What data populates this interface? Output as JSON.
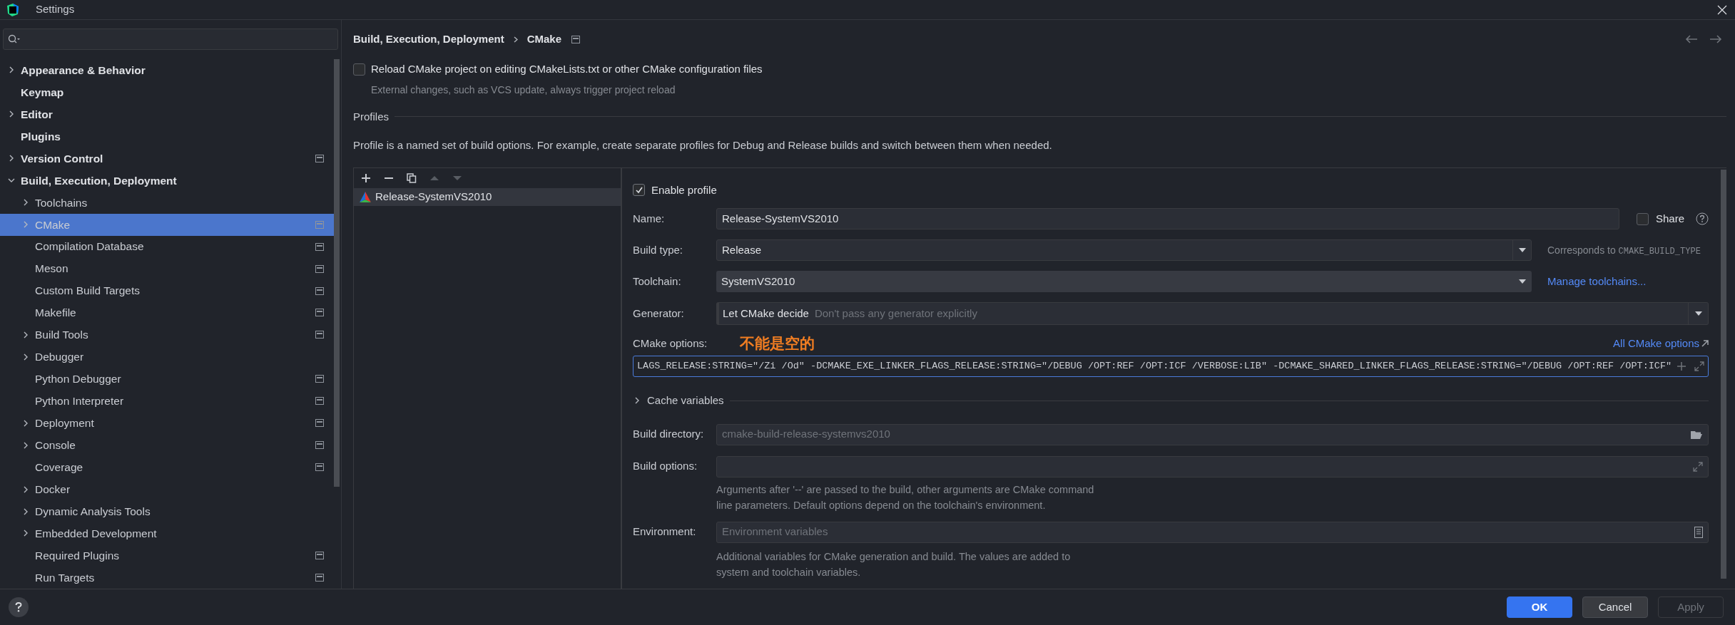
{
  "window": {
    "title": "Settings"
  },
  "sidebar": {
    "items": [
      {
        "label": "Appearance & Behavior",
        "expanded": false,
        "selected": false,
        "project_level": false
      },
      {
        "label": "Keymap",
        "selected": false,
        "project_level": false
      },
      {
        "label": "Editor",
        "expanded": false,
        "selected": false,
        "project_level": false
      },
      {
        "label": "Plugins",
        "selected": false,
        "project_level": false
      },
      {
        "label": "Version Control",
        "expanded": false,
        "selected": false,
        "project_level": true
      },
      {
        "label": "Build, Execution, Deployment",
        "expanded": true,
        "selected": false,
        "project_level": false,
        "children": [
          {
            "label": "Toolchains",
            "expanded": false,
            "selected": false,
            "project_level": false
          },
          {
            "label": "CMake",
            "expanded": false,
            "selected": true,
            "project_level": true
          },
          {
            "label": "Compilation Database",
            "selected": false,
            "project_level": true
          },
          {
            "label": "Meson",
            "selected": false,
            "project_level": true
          },
          {
            "label": "Custom Build Targets",
            "selected": false,
            "project_level": true
          },
          {
            "label": "Makefile",
            "selected": false,
            "project_level": true
          },
          {
            "label": "Build Tools",
            "expanded": false,
            "selected": false,
            "project_level": true
          },
          {
            "label": "Debugger",
            "expanded": false,
            "selected": false,
            "project_level": false
          },
          {
            "label": "Python Debugger",
            "selected": false,
            "project_level": true
          },
          {
            "label": "Python Interpreter",
            "selected": false,
            "project_level": true
          },
          {
            "label": "Deployment",
            "expanded": false,
            "selected": false,
            "project_level": true
          },
          {
            "label": "Console",
            "expanded": false,
            "selected": false,
            "project_level": true
          },
          {
            "label": "Coverage",
            "selected": false,
            "project_level": true
          },
          {
            "label": "Docker",
            "expanded": false,
            "selected": false,
            "project_level": false
          },
          {
            "label": "Dynamic Analysis Tools",
            "expanded": false,
            "selected": false,
            "project_level": false
          },
          {
            "label": "Embedded Development",
            "expanded": false,
            "selected": false,
            "project_level": false
          },
          {
            "label": "Required Plugins",
            "selected": false,
            "project_level": true
          },
          {
            "label": "Run Targets",
            "selected": false,
            "project_level": true
          }
        ]
      }
    ]
  },
  "breadcrumb": {
    "items": [
      "Build, Execution, Deployment",
      "CMake"
    ],
    "project_level": true
  },
  "reload_option": {
    "label": "Reload CMake project on editing CMakeLists.txt or other CMake configuration files",
    "checked": false,
    "hint": "External changes, such as VCS update, always trigger project reload"
  },
  "profiles": {
    "title": "Profiles",
    "description": "Profile is a named set of build options. For example, create separate profiles for Debug and Release builds and switch between them when needed.",
    "toolbar": [
      {
        "kind": "add",
        "disabled": false
      },
      {
        "kind": "remove",
        "disabled": false
      },
      {
        "kind": "copy",
        "disabled": false
      },
      {
        "kind": "up",
        "disabled": true
      },
      {
        "kind": "down",
        "disabled": true
      }
    ],
    "list": [
      {
        "name": "Release-SystemVS2010",
        "selected": true
      }
    ]
  },
  "form": {
    "enable_profile": {
      "label": "Enable profile",
      "checked": true
    },
    "name": {
      "label": "Name:",
      "value": "Release-SystemVS2010"
    },
    "share": {
      "label": "Share",
      "checked": false
    },
    "build_type": {
      "label": "Build type:",
      "value": "Release",
      "hint": "Corresponds to",
      "hint_code": "CMAKE_BUILD_TYPE"
    },
    "toolchain": {
      "label": "Toolchain:",
      "value": "SystemVS2010",
      "link": "Manage toolchains..."
    },
    "generator": {
      "label": "Generator:",
      "value": "Let CMake decide",
      "hint": "Don't pass any generator explicitly"
    },
    "cmake_options": {
      "label": "CMake options:",
      "annotation": "不能是空的",
      "link": "All CMake options",
      "value": "LAGS_RELEASE:STRING=\"/Zi /Od\" -DCMAKE_EXE_LINKER_FLAGS_RELEASE:STRING=\"/DEBUG /OPT:REF /OPT:ICF /VERBOSE:LIB\" -DCMAKE_SHARED_LINKER_FLAGS_RELEASE:STRING=\"/DEBUG /OPT:REF /OPT:ICF\""
    },
    "cache_variables": {
      "label": "Cache variables",
      "expanded": false
    },
    "build_directory": {
      "label": "Build directory:",
      "placeholder": "cmake-build-release-systemvs2010"
    },
    "build_options": {
      "label": "Build options:",
      "help": [
        "Arguments after '--' are passed to the build, other arguments are CMake command",
        "line parameters. Default options depend on the toolchain's environment."
      ]
    },
    "environment": {
      "label": "Environment:",
      "placeholder": "Environment variables",
      "help": [
        "Additional variables for CMake generation and build. The values are added to",
        "system and toolchain variables."
      ]
    }
  },
  "buttons": [
    {
      "label": "OK",
      "primary": true,
      "disabled": false
    },
    {
      "label": "Cancel",
      "primary": false,
      "disabled": false
    },
    {
      "label": "Apply",
      "primary": false,
      "disabled": true
    }
  ]
}
